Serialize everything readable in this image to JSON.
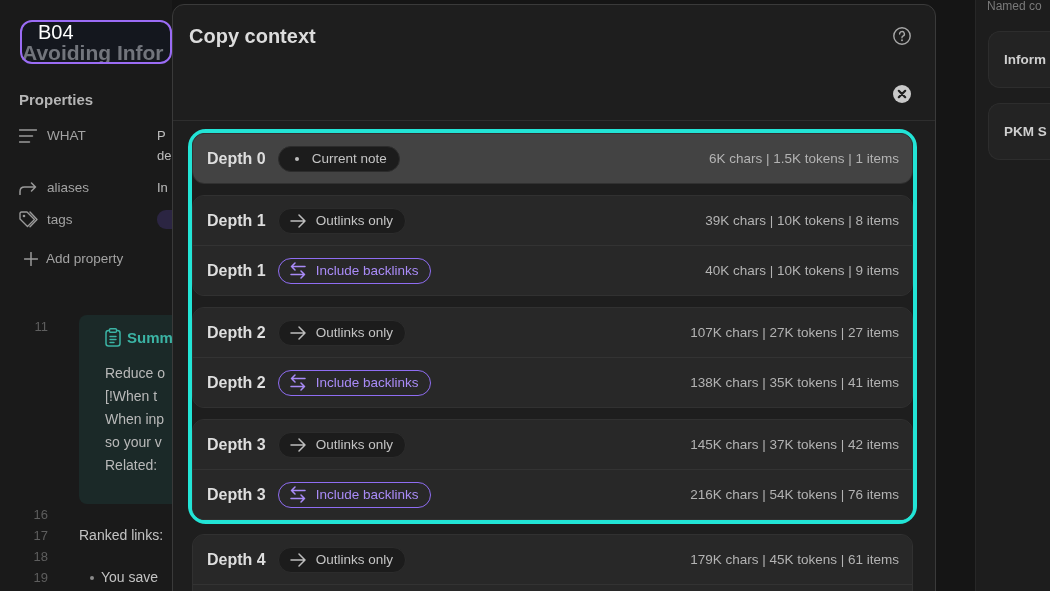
{
  "annotation_label": "B04",
  "note": {
    "title": "Avoiding Infor",
    "properties_heading": "Properties",
    "properties": [
      {
        "kind": "text",
        "name": "WHAT",
        "value_lines": [
          "P",
          "de"
        ]
      },
      {
        "kind": "aliases",
        "name": "aliases",
        "value_lines": [
          "In"
        ]
      },
      {
        "kind": "tags",
        "name": "tags"
      }
    ],
    "add_property": "Add property",
    "lines": [
      {
        "number": "11",
        "kind": "callout",
        "title": "Summ",
        "body": [
          "Reduce o",
          "[!When t",
          "When inp",
          "so your v",
          "Related:"
        ]
      },
      {
        "number": "16",
        "kind": "blank"
      },
      {
        "number": "17",
        "kind": "text",
        "text": "Ranked links:"
      },
      {
        "number": "18",
        "kind": "blank"
      },
      {
        "number": "19",
        "kind": "bullet",
        "text": "You save"
      }
    ]
  },
  "dialog": {
    "title": "Copy context",
    "sections": [
      {
        "highlighted": true,
        "groups": [
          {
            "rows": [
              {
                "depth": "Depth 0",
                "mode": {
                  "kind": "current",
                  "label": "Current note"
                },
                "stats": "6K chars | 1.5K tokens | 1 items",
                "selected": true
              }
            ]
          },
          {
            "rows": [
              {
                "depth": "Depth 1",
                "mode": {
                  "kind": "outlinks",
                  "label": "Outlinks only"
                },
                "stats": "39K chars | 10K tokens | 8 items",
                "selected": false
              },
              {
                "depth": "Depth 1",
                "mode": {
                  "kind": "backlinks",
                  "label": "Include backlinks"
                },
                "stats": "40K chars | 10K tokens | 9 items",
                "selected": false
              }
            ]
          },
          {
            "rows": [
              {
                "depth": "Depth 2",
                "mode": {
                  "kind": "outlinks",
                  "label": "Outlinks only"
                },
                "stats": "107K chars | 27K tokens | 27 items",
                "selected": false
              },
              {
                "depth": "Depth 2",
                "mode": {
                  "kind": "backlinks",
                  "label": "Include backlinks"
                },
                "stats": "138K chars | 35K tokens | 41 items",
                "selected": false
              }
            ]
          },
          {
            "rows": [
              {
                "depth": "Depth 3",
                "mode": {
                  "kind": "outlinks",
                  "label": "Outlinks only"
                },
                "stats": "145K chars | 37K tokens | 42 items",
                "selected": false
              },
              {
                "depth": "Depth 3",
                "mode": {
                  "kind": "backlinks",
                  "label": "Include backlinks"
                },
                "stats": "216K chars | 54K tokens | 76 items",
                "selected": false
              }
            ]
          }
        ]
      },
      {
        "highlighted": false,
        "groups": [
          {
            "rows": [
              {
                "depth": "Depth 4",
                "mode": {
                  "kind": "outlinks",
                  "label": "Outlinks only"
                },
                "stats": "179K chars | 45K tokens | 61 items",
                "selected": false
              }
            ]
          }
        ]
      }
    ]
  },
  "side_panel": {
    "heading": "Named co",
    "cards": [
      "Inform",
      "PKM S"
    ]
  }
}
